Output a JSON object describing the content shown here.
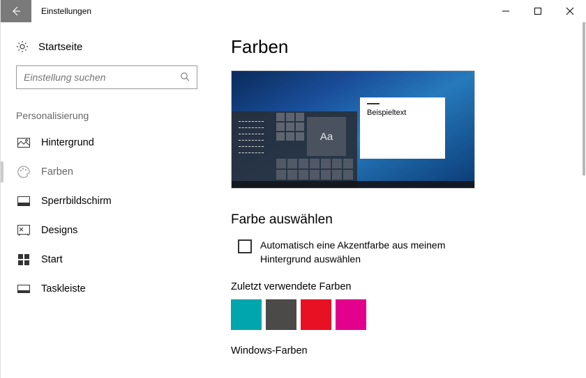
{
  "window": {
    "title": "Einstellungen"
  },
  "sidebar": {
    "home_label": "Startseite",
    "search_placeholder": "Einstellung suchen",
    "group_label": "Personalisierung",
    "items": [
      {
        "label": "Hintergrund"
      },
      {
        "label": "Farben"
      },
      {
        "label": "Sperrbildschirm"
      },
      {
        "label": "Designs"
      },
      {
        "label": "Start"
      },
      {
        "label": "Taskleiste"
      }
    ]
  },
  "main": {
    "title": "Farben",
    "preview": {
      "sample_text": "Beispieltext",
      "tile_text": "Aa"
    },
    "choose_color_heading": "Farbe auswählen",
    "auto_color_label": "Automatisch eine Akzentfarbe aus meinem Hintergrund auswählen",
    "recent_heading": "Zuletzt verwendete Farben",
    "recent_colors": [
      "#00a6ad",
      "#4c4a48",
      "#e81123",
      "#e3008c"
    ],
    "windows_colors_heading": "Windows-Farben"
  }
}
